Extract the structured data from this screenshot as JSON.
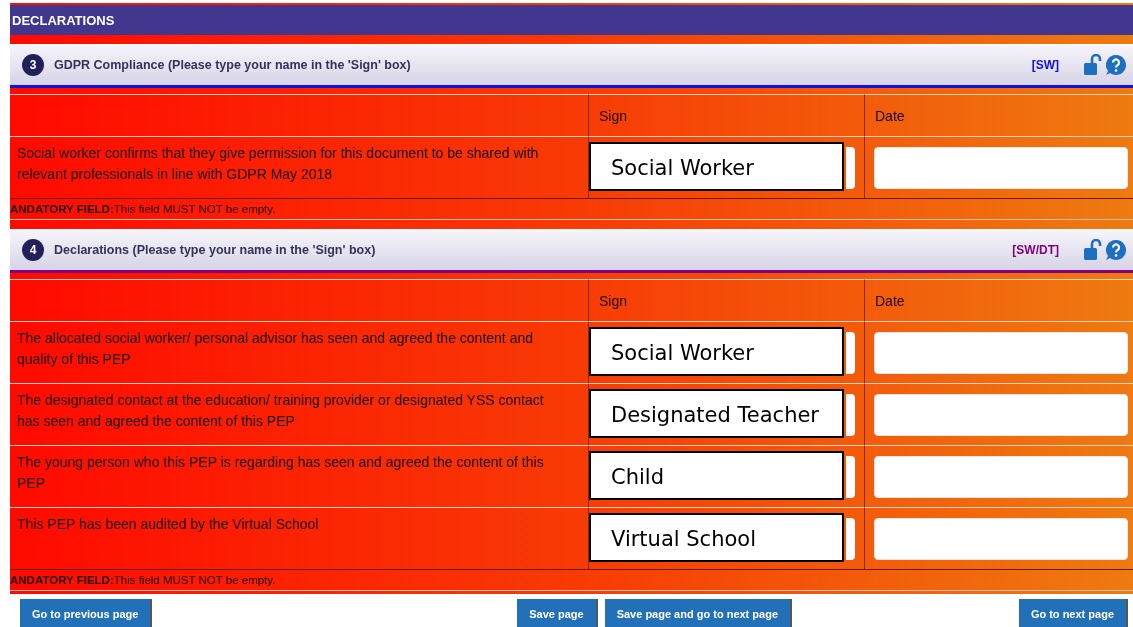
{
  "page_title": "DECLARATIONS",
  "sections": [
    {
      "number": "3",
      "title": "GDPR Compliance (Please type your name in the 'Sign' box)",
      "tag": "[SW]",
      "color": "#1010e0",
      "columns": [
        "Sign",
        "Date"
      ],
      "rows": [
        {
          "text": "Social worker confirms that they give permission for this document to be shared with relevant professionals in line with GDPR May 2018",
          "sign": "Social Worker"
        }
      ],
      "mandatory_note": "**ANDATORY FIELD:**This field MUST NOT be empty."
    },
    {
      "number": "4",
      "title": "Declarations (Please type your name in the 'Sign' box)",
      "tag": "[SW/DT]",
      "color": "#800080",
      "columns": [
        "Sign",
        "Date"
      ],
      "rows": [
        {
          "text": "The allocated social worker/ personal advisor has seen and agreed the content and quality of this PEP",
          "sign": "Social Worker"
        },
        {
          "text": "The designated contact at the education/ training provider or designated YSS contact has seen and agreed the content of this PEP",
          "sign": "Designated Teacher"
        },
        {
          "text": "The young person who this PEP is regarding has seen and agreed the content of this PEP",
          "sign": "Child"
        },
        {
          "text": "This PEP has been audited by the Virtual School",
          "sign": "Virtual School"
        }
      ],
      "mandatory_note": "**ANDATORY FIELD:**This field MUST NOT be empty."
    }
  ],
  "buttons": [
    {
      "label": "Go to previous page"
    },
    {
      "label": "Save page"
    },
    {
      "label": "Save page and go to next page"
    },
    {
      "label": "Go to next page"
    }
  ]
}
